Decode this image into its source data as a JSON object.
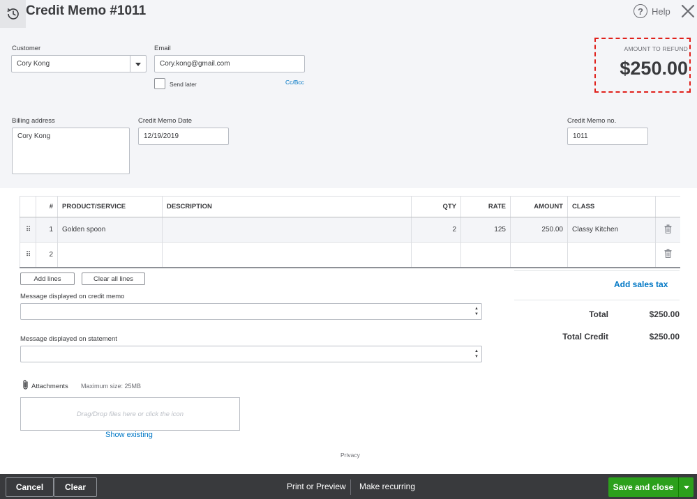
{
  "header": {
    "title": "Credit Memo #1011",
    "help_label": "Help"
  },
  "form": {
    "customer_label": "Customer",
    "customer_value": "Cory Kong",
    "email_label": "Email",
    "email_value": "Cory.kong@gmail.com",
    "send_later_label": "Send later",
    "cc_bcc_label": "Cc/Bcc",
    "billing_label": "Billing address",
    "billing_value": "Cory Kong",
    "date_label": "Credit Memo Date",
    "date_value": "12/19/2019",
    "memo_no_label": "Credit Memo no.",
    "memo_no_value": "1011"
  },
  "refund": {
    "label": "AMOUNT TO REFUND",
    "amount": "$250.00"
  },
  "table": {
    "columns": [
      "#",
      "PRODUCT/SERVICE",
      "DESCRIPTION",
      "QTY",
      "RATE",
      "AMOUNT",
      "CLASS"
    ],
    "rows": [
      {
        "num": "1",
        "product": "Golden spoon",
        "description": "",
        "qty": "2",
        "rate": "125",
        "amount": "250.00",
        "class": "Classy Kitchen"
      },
      {
        "num": "2",
        "product": "",
        "description": "",
        "qty": "",
        "rate": "",
        "amount": "",
        "class": ""
      }
    ]
  },
  "actions": {
    "add_lines": "Add lines",
    "clear_all_lines": "Clear all lines"
  },
  "totals": {
    "add_sales_tax": "Add sales tax",
    "total_label": "Total",
    "total_value": "$250.00",
    "total_credit_label": "Total Credit",
    "total_credit_value": "$250.00"
  },
  "messages": {
    "memo_label": "Message displayed on credit memo",
    "statement_label": "Message displayed on statement"
  },
  "attachments": {
    "label": "Attachments",
    "max_size": "Maximum size: 25MB",
    "dropzone_text": "Drag/Drop files here or click the icon",
    "show_existing": "Show existing"
  },
  "privacy": "Privacy",
  "footer": {
    "cancel": "Cancel",
    "clear": "Clear",
    "print_preview": "Print or Preview",
    "make_recurring": "Make recurring",
    "save_close": "Save and close"
  },
  "colors": {
    "accent_green": "#2ca01c",
    "link_blue": "#0077c5",
    "footer_bg": "#393a3d",
    "refund_border": "#e0201b"
  }
}
